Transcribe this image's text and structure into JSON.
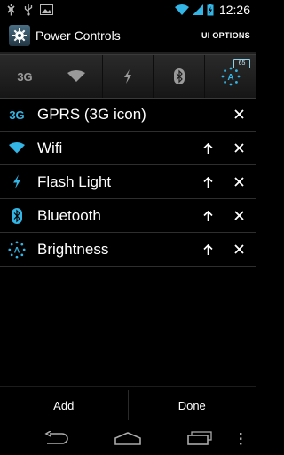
{
  "status_bar": {
    "time": "12:26",
    "left_icons": [
      "usb-debug-icon",
      "usb-icon",
      "image-icon"
    ],
    "right_icons": [
      "wifi-icon",
      "signal-icon",
      "battery-charging-icon"
    ]
  },
  "action_bar": {
    "title": "Power Controls",
    "ui_options_label": "UI OPTIONS"
  },
  "widget": {
    "cells": [
      "3g-icon",
      "wifi-icon",
      "flash-light-icon",
      "bluetooth-icon",
      "brightness-auto-icon"
    ],
    "battery_level": "65"
  },
  "controls": [
    {
      "label": "GPRS (3G icon)",
      "icon": "3g-icon",
      "has_up": false
    },
    {
      "label": "Wifi",
      "icon": "wifi-icon",
      "has_up": true
    },
    {
      "label": "Flash Light",
      "icon": "flash-light-icon",
      "has_up": true
    },
    {
      "label": "Bluetooth",
      "icon": "bluetooth-icon",
      "has_up": true
    },
    {
      "label": "Brightness",
      "icon": "brightness-icon",
      "has_up": true
    }
  ],
  "buttons": {
    "add_label": "Add",
    "done_label": "Done"
  },
  "nav_bar": [
    "back-icon",
    "home-icon",
    "recent-apps-icon",
    "menu-icon"
  ],
  "colors": {
    "accent": "#33b5e5",
    "widget_icon": "#9a9a9a",
    "background": "#000000"
  }
}
